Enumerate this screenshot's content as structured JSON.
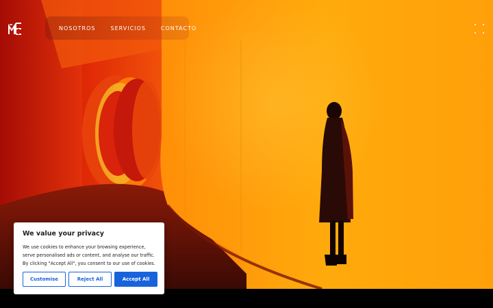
{
  "nav": {
    "items": [
      {
        "label": "NOSOTROS"
      },
      {
        "label": "SERVICIOS"
      },
      {
        "label": "CONTACTO"
      }
    ]
  },
  "logo": {
    "text": "MA"
  },
  "menu": {
    "icon": "grid-dots-icon"
  },
  "cookie_banner": {
    "title": "We value your privacy",
    "body_line1": "We use cookies to enhance your browsing experience,",
    "body_line2": "serve personalised ads or content, and analyse our traffic.",
    "body_line3": "By clicking \"Accept All\", you consent to our use of cookies.",
    "customise_label": "Customise",
    "reject_label": "Reject All",
    "accept_label": "Accept All"
  },
  "colors": {
    "accept_blue": "#1863dc",
    "hero_orange": "#ffa20d",
    "hero_red": "#c8130a"
  }
}
